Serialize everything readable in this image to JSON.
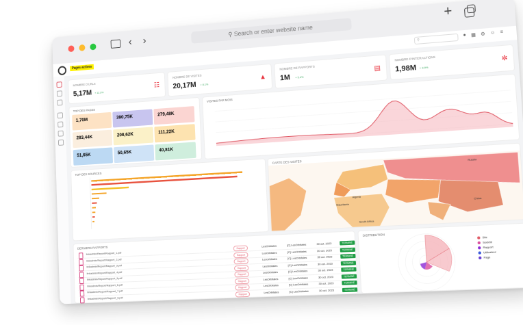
{
  "browser": {
    "search_placeholder": "Search or enter website name"
  },
  "app": {
    "workspace_badge": "Pages actives"
  },
  "kpis": [
    {
      "label": "NOMBRE D'URLS",
      "value": "5,17M",
      "delta": "+ 12.3%"
    },
    {
      "label": "NOMBRE DE VISITES",
      "value": "20,17M",
      "delta": "+ 8.1%"
    },
    {
      "label": "NOMBRE DE RAPPORTS",
      "value": "1M",
      "delta": "+ 5.4%"
    },
    {
      "label": "NOMBRE D'INTERACTIONS",
      "value": "1,98M",
      "delta": "+ 3.9%"
    }
  ],
  "tiles_panel": {
    "title": "TOP DES PAGES",
    "tiles": [
      {
        "value": "1,70M",
        "label": "",
        "color": "#fde2c4"
      },
      {
        "value": "390,75K",
        "label": "",
        "color": "#c8c5ef"
      },
      {
        "value": "279,48K",
        "label": "",
        "color": "#fbd5d2"
      },
      {
        "value": "283,44K",
        "label": "",
        "color": "#fbeede"
      },
      {
        "value": "208,62K",
        "label": "",
        "color": "#fbf1c8"
      },
      {
        "value": "111,22K",
        "label": "",
        "color": "#fde3b0"
      },
      {
        "value": "51,65K",
        "label": "",
        "color": "#bcd9f3"
      },
      {
        "value": "50,65K",
        "label": "",
        "color": "#cfe3f7"
      },
      {
        "value": "40,81K",
        "label": "",
        "color": "#cfeedd"
      }
    ]
  },
  "line_panel": {
    "title": "VISITES PAR MOIS",
    "color": "#e05a66"
  },
  "bars_panel": {
    "title": "TOP DES SOURCES",
    "colors": [
      "#f4a52a",
      "#e8533f",
      "#f4c12a"
    ]
  },
  "map_panel": {
    "title": "CARTE DES VISITES",
    "labels": [
      "Russia",
      "China",
      "Mauritania",
      "Algeria",
      "South Africa"
    ]
  },
  "table_panel": {
    "title": "DERNIERS RAPPORTS",
    "rows": [
      {
        "url": "linkadmin/Report/Rapport_1.pdf",
        "type": "Rapport",
        "name": "LesOrbitales",
        "owner": "[C] LesOrbitales",
        "date": "30 oct. 2023",
        "status": "TERMINÉ"
      },
      {
        "url": "linkadmin/Report/Rapport_2.pdf",
        "type": "Rapport",
        "name": "LesOrbitales",
        "owner": "[C] LesOrbitales",
        "date": "30 oct. 2023",
        "status": "TERMINÉ"
      },
      {
        "url": "linkadmin/Report/Rapport_3.pdf",
        "type": "Rapport",
        "name": "LesOrbitales",
        "owner": "[C] LesOrbitales",
        "date": "30 oct. 2023",
        "status": "TERMINÉ"
      },
      {
        "url": "linkadmin/Report/Rapport_4.pdf",
        "type": "Rapport",
        "name": "LesOrbitales",
        "owner": "[C] LesOrbitales",
        "date": "30 oct. 2023",
        "status": "TERMINÉ"
      },
      {
        "url": "linkadmin/Report/Rapport_5.pdf",
        "type": "Rapport",
        "name": "LesOrbitales",
        "owner": "[C] LesOrbitales",
        "date": "30 oct. 2023",
        "status": "TERMINÉ"
      },
      {
        "url": "linkadmin/Report/Rapport_6.pdf",
        "type": "Rapport",
        "name": "LesOrbitales",
        "owner": "[C] LesOrbitales",
        "date": "30 oct. 2023",
        "status": "TERMINÉ"
      },
      {
        "url": "linkadmin/Report/Rapport_7.pdf",
        "type": "Rapport",
        "name": "LesOrbitales",
        "owner": "[C] LesOrbitales",
        "date": "30 oct. 2023",
        "status": "TERMINÉ"
      },
      {
        "url": "linkadmin/Report/Rapport_8.pdf",
        "type": "Rapport",
        "name": "LesOrbitales",
        "owner": "[C] LesOrbitales",
        "date": "30 oct. 2023",
        "status": "TERMINÉ"
      }
    ]
  },
  "polar_panel": {
    "title": "DISTRIBUTION",
    "legend": [
      {
        "label": "Site",
        "color": "#e05a66"
      },
      {
        "label": "Société",
        "color": "#d94d9c"
      },
      {
        "label": "Rapport",
        "color": "#8a2bd6"
      },
      {
        "label": "Utilisateur",
        "color": "#3b5bdb"
      },
      {
        "label": "Page",
        "color": "#6a3fd3"
      }
    ]
  }
}
